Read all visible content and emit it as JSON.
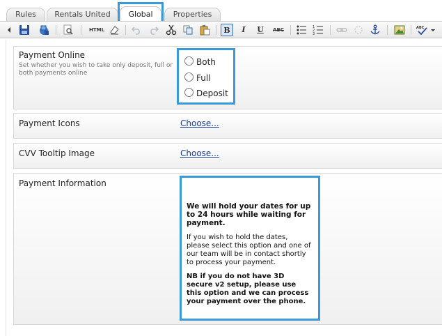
{
  "tabs": [
    {
      "label": "Rules"
    },
    {
      "label": "Rentals United"
    },
    {
      "label": "Global"
    },
    {
      "label": "Properties"
    }
  ],
  "toolbar": {
    "html_label": "HTML",
    "bold_label": "B",
    "italic_label": "I",
    "underline_label": "U",
    "strike_label": "ABC",
    "spell_label": "ABC"
  },
  "payment_online": {
    "label": "Payment Online",
    "description": "Set whether you wish to take only deposit, full or both payments online",
    "options": [
      "Both",
      "Full",
      "Deposit"
    ]
  },
  "payment_icons": {
    "label": "Payment Icons",
    "link": "Choose..."
  },
  "cvv_tooltip": {
    "label": "CVV Tooltip Image",
    "link": "Choose..."
  },
  "payment_information": {
    "label": "Payment Information",
    "paragraphs": [
      "We will hold your dates for up to 24 hours while waiting for payment.",
      "If you wish to hold the dates, please select this option and one of our team will be in contact shortly to process your payment.",
      "NB if you do not have 3D secure v2 setup, please use this option and we can process your payment over the phone."
    ]
  },
  "colors": {
    "highlight": "#3a9ad9",
    "link": "#1a3c8a"
  }
}
